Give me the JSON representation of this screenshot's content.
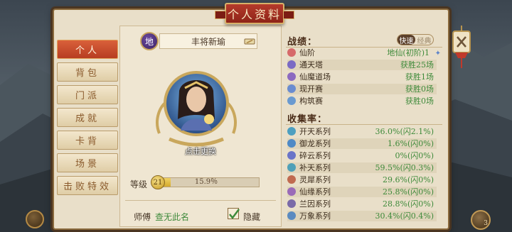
{
  "window": {
    "title": "个人资料"
  },
  "sidebar": {
    "items": [
      {
        "label": "个人",
        "active": true
      },
      {
        "label": "背包",
        "active": false
      },
      {
        "label": "门派",
        "active": false
      },
      {
        "label": "成就",
        "active": false
      },
      {
        "label": "卡背",
        "active": false
      },
      {
        "label": "场景",
        "active": false
      },
      {
        "label": "击败特效",
        "active": false
      }
    ]
  },
  "profile": {
    "realm_badge": "地",
    "name": "丰将新瑜",
    "change_avatar": "点击更换",
    "level_label": "等级",
    "level": "21",
    "level_progress_text": "15.9％",
    "level_progress": 0.159,
    "master_label": "师傅",
    "master_value": "查无此名",
    "hide_label": "隐藏",
    "hide_checked": true
  },
  "record": {
    "title": "战绩：",
    "toggle": {
      "on": "快速",
      "off": "经典"
    },
    "rows": [
      {
        "icon": "realm-icon",
        "icon_color": "#d66a6a",
        "label": "仙阶",
        "value": "地仙(初阶)1"
      },
      {
        "icon": "tower-icon",
        "icon_color": "#7a6ac4",
        "label": "通天塔",
        "value": "获胜25场"
      },
      {
        "icon": "arena-icon",
        "icon_color": "#8c6ac0",
        "label": "仙魔道场",
        "value": "获胜1场"
      },
      {
        "icon": "match-icon",
        "icon_color": "#6a8cd0",
        "label": "现开赛",
        "value": "获胜0场"
      },
      {
        "icon": "build-icon",
        "icon_color": "#6a9ad0",
        "label": "构筑赛",
        "value": "获胜0场"
      }
    ]
  },
  "collection": {
    "title": "收集率：",
    "rows": [
      {
        "icon": "series-icon",
        "icon_color": "#4d9fc0",
        "label": "开天系列",
        "value": "36.0%(闪2.1%)"
      },
      {
        "icon": "series-icon",
        "icon_color": "#4f8ac6",
        "label": "御龙系列",
        "value": "1.6%(闪0%)"
      },
      {
        "icon": "series-icon",
        "icon_color": "#6a74c8",
        "label": "碎云系列",
        "value": "0%(闪0%)"
      },
      {
        "icon": "series-icon",
        "icon_color": "#4fa0b8",
        "label": "补天系列",
        "value": "59.5%(闪0.3%)"
      },
      {
        "icon": "series-icon",
        "icon_color": "#c06a50",
        "label": "灵犀系列",
        "value": "29.6%(闪0%)"
      },
      {
        "icon": "series-icon",
        "icon_color": "#9a6ab8",
        "label": "仙缘系列",
        "value": "25.8%(闪0%)"
      },
      {
        "icon": "series-icon",
        "icon_color": "#7a6aa8",
        "label": "兰因系列",
        "value": "28.8%(闪0%)"
      },
      {
        "icon": "series-icon",
        "icon_color": "#5b8ac0",
        "label": "万象系列",
        "value": "30.4%(闪0.4%)"
      }
    ]
  },
  "corner_right_badge": "3"
}
